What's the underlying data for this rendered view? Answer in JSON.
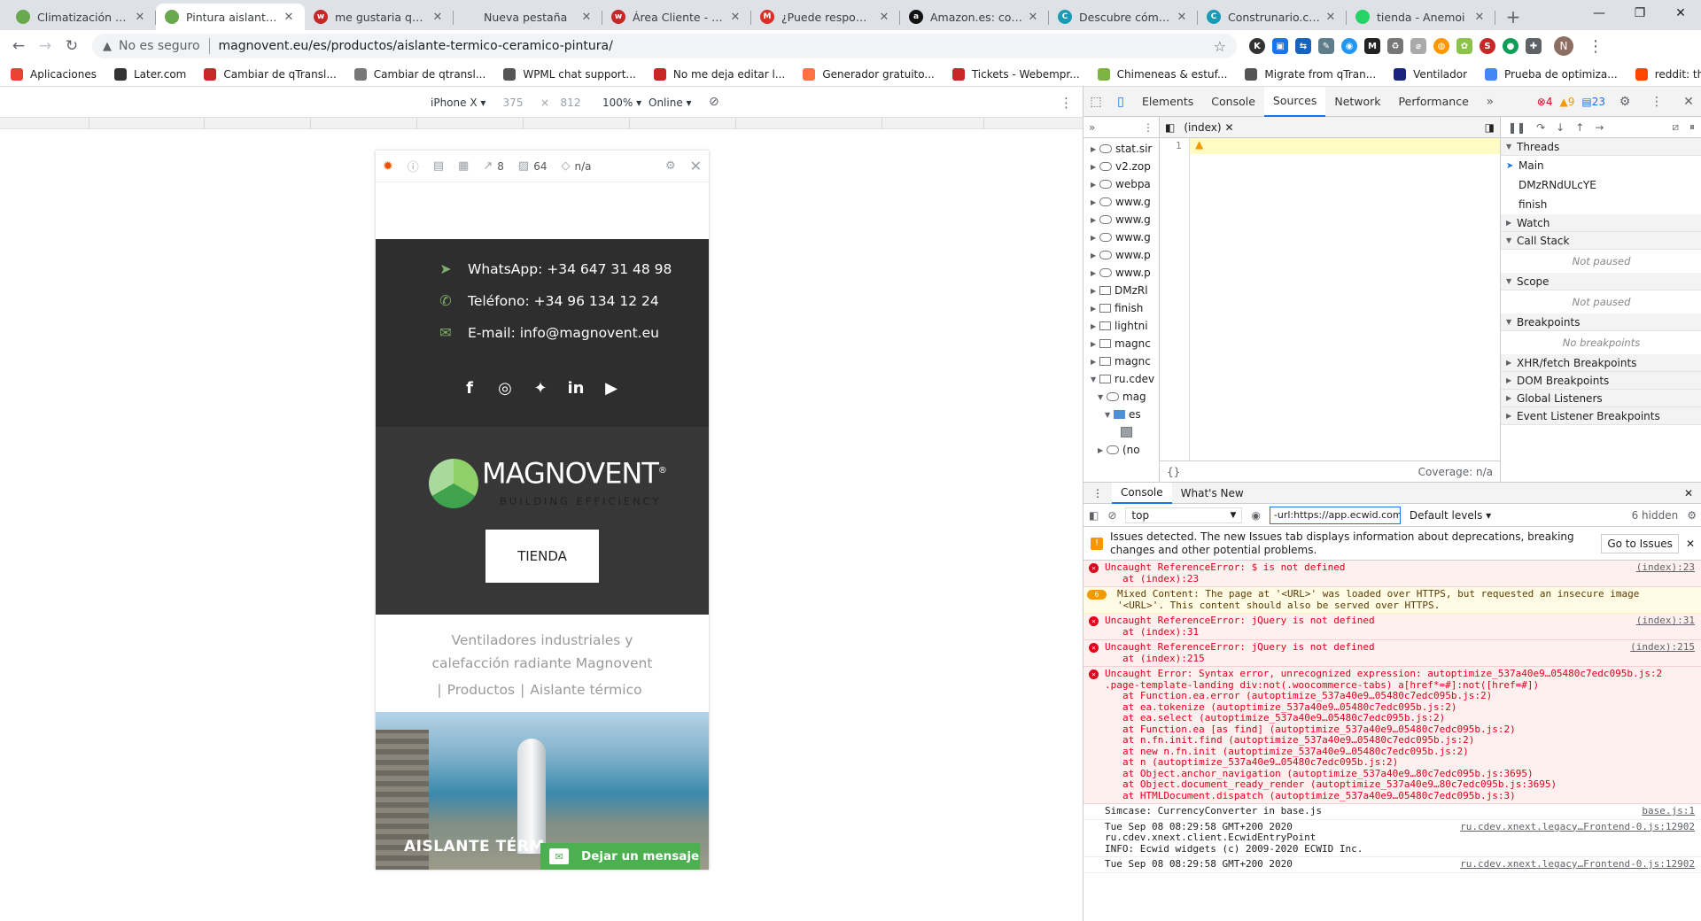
{
  "browser": {
    "tabs": [
      {
        "title": "Climatización con v",
        "fav_color": "#6aa84f",
        "fav": ""
      },
      {
        "title": "Pintura aislante térm",
        "fav_color": "#6aa84f",
        "fav": "",
        "active": true
      },
      {
        "title": "me gustaria que m",
        "fav_color": "#c62828",
        "fav": "w"
      },
      {
        "title": "Nueva pestaña",
        "fav_color": "",
        "fav": ""
      },
      {
        "title": "Área Cliente - Web",
        "fav_color": "#c62828",
        "fav": "w"
      },
      {
        "title": "¿Puede responder e",
        "fav_color": "#d93025",
        "fav": "M"
      },
      {
        "title": "Amazon.es: compra",
        "fav_color": "#111111",
        "fav": "a"
      },
      {
        "title": "Descubre cómo me",
        "fav_color": "#1a9bb5",
        "fav": "C"
      },
      {
        "title": "Construnario.com -",
        "fav_color": "#1a9bb5",
        "fav": "C"
      },
      {
        "title": "tienda - Anemoi",
        "fav_color": "#25d366",
        "fav": ""
      }
    ],
    "new_tab": "+",
    "url_warning": "No es seguro",
    "url": "magnovent.eu/es/productos/aislante-termico-ceramico-pintura/",
    "avatar": "N",
    "bookmarks": [
      {
        "label": "Aplicaciones",
        "color": "#ea4335"
      },
      {
        "label": "Later.com",
        "color": "#333333"
      },
      {
        "label": "Cambiar de qTransl...",
        "color": "#c62828"
      },
      {
        "label": "Cambiar de qtransl...",
        "color": "#777777"
      },
      {
        "label": "WPML chat support...",
        "color": "#555555"
      },
      {
        "label": "No me deja editar l...",
        "color": "#c62828"
      },
      {
        "label": "Generador gratuito...",
        "color": "#ff7043"
      },
      {
        "label": "Tickets - Webempr...",
        "color": "#c62828"
      },
      {
        "label": "Chimeneas & estuf...",
        "color": "#7cb342"
      },
      {
        "label": "Migrate from qTran...",
        "color": "#555555"
      },
      {
        "label": "Ventilador",
        "color": "#1a237e"
      },
      {
        "label": "Prueba de optimiza...",
        "color": "#4285f4"
      },
      {
        "label": "reddit: the front pa...",
        "color": "#ff4500"
      }
    ]
  },
  "device_toolbar": {
    "device": "iPhone X ▾",
    "width": "375",
    "height": "812",
    "zoom": "100% ▾",
    "network": "Online ▾"
  },
  "mobile_page": {
    "qbar": {
      "links": "8",
      "images": "64",
      "score": "n/a"
    },
    "contact": {
      "whatsapp": "WhatsApp: +34 647 31 48 98",
      "phone": "Teléfono: +34 96 134 12 24",
      "email": "E-mail: info@magnovent.eu"
    },
    "logo_title": "MAGNOVENT",
    "logo_sub": "BUILDING EFFICIENCY",
    "shop_button": "TIENDA",
    "breadcrumb_text": "Ventiladores industriales y calefacción radiante Magnovent",
    "breadcrumb_links": [
      "Productos",
      "Aislante térmico"
    ],
    "hero_title": "AISLANTE TÉRM",
    "message_button": "Dejar un mensaje"
  },
  "devtools": {
    "tabs": [
      "Elements",
      "Console",
      "Sources",
      "Network",
      "Performance"
    ],
    "active_tab": "Sources",
    "errors": "4",
    "warnings": "9",
    "infos": "23",
    "nav_items": [
      {
        "label": "stat.sir",
        "type": "cloud",
        "indent": 1,
        "arrow": "▶"
      },
      {
        "label": "v2.zop",
        "type": "cloud",
        "indent": 1,
        "arrow": "▶"
      },
      {
        "label": "webpa",
        "type": "cloud",
        "indent": 1,
        "arrow": "▶"
      },
      {
        "label": "www.g",
        "type": "cloud",
        "indent": 1,
        "arrow": "▶"
      },
      {
        "label": "www.g",
        "type": "cloud",
        "indent": 1,
        "arrow": "▶"
      },
      {
        "label": "www.g",
        "type": "cloud",
        "indent": 1,
        "arrow": "▶"
      },
      {
        "label": "www.p",
        "type": "cloud",
        "indent": 1,
        "arrow": "▶"
      },
      {
        "label": "www.p",
        "type": "cloud",
        "indent": 1,
        "arrow": "▶"
      },
      {
        "label": "DMzRl",
        "type": "frame",
        "indent": 1,
        "arrow": "▶"
      },
      {
        "label": "finish",
        "type": "frame",
        "indent": 1,
        "arrow": "▶"
      },
      {
        "label": "lightni",
        "type": "frame",
        "indent": 1,
        "arrow": "▶"
      },
      {
        "label": "magnc",
        "type": "frame",
        "indent": 1,
        "arrow": "▶"
      },
      {
        "label": "magnc",
        "type": "frame",
        "indent": 1,
        "arrow": "▶"
      },
      {
        "label": "ru.cdev",
        "type": "frame",
        "indent": 1,
        "arrow": "▼"
      },
      {
        "label": "mag",
        "type": "cloud",
        "indent": 2,
        "arrow": "▼"
      },
      {
        "label": "es",
        "type": "folder",
        "indent": 3,
        "arrow": "▼"
      },
      {
        "label": "",
        "type": "file",
        "indent": 4,
        "arrow": ""
      },
      {
        "label": "(no",
        "type": "cloud",
        "indent": 2,
        "arrow": "▶"
      }
    ],
    "editor_file": "(index)",
    "line_number": "1",
    "coverage": "Coverage: n/a",
    "threads_label": "Threads",
    "threads": [
      "Main",
      "DMzRNdULcYE",
      "finish"
    ],
    "watch": "Watch",
    "call_stack": "Call Stack",
    "not_paused": "Not paused",
    "scope": "Scope",
    "breakpoints": "Breakpoints",
    "no_breakpoints": "No breakpoints",
    "xhr": "XHR/fetch Breakpoints",
    "dom": "DOM Breakpoints",
    "global": "Global Listeners",
    "event": "Event Listener Breakpoints",
    "drawer_tabs": [
      "Console",
      "What's New"
    ],
    "context": "top",
    "filter_value": "-url:https://app.ecwid.com",
    "levels": "Default levels ▾",
    "hidden": "6 hidden",
    "issues_text": "Issues detected. The new Issues tab displays information about deprecations, breaking changes and other potential problems.",
    "issues_button": "Go to Issues",
    "logs": [
      {
        "kind": "err",
        "lines": [
          "Uncaught ReferenceError: $ is not defined",
          "at (index):23"
        ],
        "src": "(index):23"
      },
      {
        "kind": "warn",
        "badge": "6",
        "lines": [
          "Mixed Content: The page at '<URL>' was loaded over HTTPS, but requested an insecure image",
          "'<URL>'. This content should also be served over HTTPS."
        ],
        "src": ""
      },
      {
        "kind": "err",
        "lines": [
          "Uncaught ReferenceError: jQuery is not defined",
          "at (index):31"
        ],
        "src": "(index):31"
      },
      {
        "kind": "err",
        "lines": [
          "Uncaught ReferenceError: jQuery is not defined",
          "at (index):215"
        ],
        "src": "(index):215"
      },
      {
        "kind": "err",
        "lines": [
          "Uncaught Error: Syntax error, unrecognized expression: autoptimize_537a40e9…05480c7edc095b.js:2",
          ".page-template-landing div:not(.woocommerce-tabs) a[href*=#]:not([href=#])",
          "at Function.ea.error (autoptimize_537a40e9…05480c7edc095b.js:2)",
          "at ea.tokenize (autoptimize_537a40e9…05480c7edc095b.js:2)",
          "at ea.select (autoptimize_537a40e9…05480c7edc095b.js:2)",
          "at Function.ea [as find] (autoptimize_537a40e9…05480c7edc095b.js:2)",
          "at n.fn.init.find (autoptimize_537a40e9…05480c7edc095b.js:2)",
          "at new n.fn.init (autoptimize_537a40e9…05480c7edc095b.js:2)",
          "at n (autoptimize_537a40e9…05480c7edc095b.js:2)",
          "at Object.anchor_navigation (autoptimize_537a40e9…80c7edc095b.js:3695)",
          "at Object.document_ready_render (autoptimize_537a40e9…80c7edc095b.js:3695)",
          "at HTMLDocument.dispatch (autoptimize_537a40e9…05480c7edc095b.js:3)"
        ],
        "src": ""
      },
      {
        "kind": "info",
        "lines": [
          "Simcase: CurrencyConverter in base.js"
        ],
        "src": "base.js:1"
      },
      {
        "kind": "info",
        "lines": [
          "Tue Sep 08 08:29:58 GMT+200 2020",
          "ru.cdev.xnext.client.EcwidEntryPoint",
          "INFO: Ecwid widgets (c) 2009-2020 ECWID Inc."
        ],
        "src": "ru.cdev.xnext.legacy…Frontend-0.js:12902"
      },
      {
        "kind": "info",
        "lines": [
          "Tue Sep 08 08:29:58 GMT+200 2020"
        ],
        "src": "ru.cdev.xnext.legacy…Frontend-0.js:12902"
      }
    ]
  }
}
